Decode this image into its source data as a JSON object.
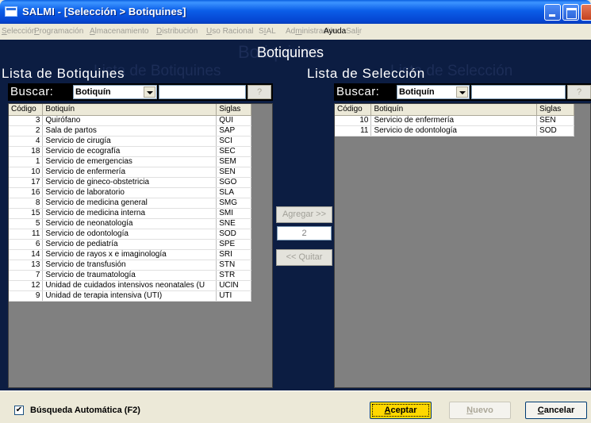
{
  "window": {
    "title": "SALMI - [Selección > Botiquines]"
  },
  "menu": [
    {
      "pre": "",
      "key": "S",
      "rest": "elección",
      "enabled": false
    },
    {
      "pre": "",
      "key": "P",
      "rest": "rogramación",
      "enabled": false
    },
    {
      "pre": "",
      "key": "A",
      "rest": "lmacenamiento",
      "enabled": false
    },
    {
      "pre": "",
      "key": "D",
      "rest": "istribución",
      "enabled": false
    },
    {
      "pre": "",
      "key": "U",
      "rest": "so Racional",
      "enabled": false
    },
    {
      "pre": "S",
      "key": "I",
      "rest": "AL",
      "enabled": false
    },
    {
      "pre": "Ad",
      "key": "m",
      "rest": "inistración",
      "enabled": false
    },
    {
      "pre": "",
      "key": "",
      "rest": "Ayuda",
      "enabled": true
    },
    {
      "pre": "Sal",
      "key": "i",
      "rest": "r",
      "enabled": false
    }
  ],
  "page": {
    "title": "Botiquines"
  },
  "left": {
    "title": "Lista de Botiquines",
    "search_label": "Buscar:",
    "search_field": "Botiquín",
    "search_value": "",
    "help_label": "?",
    "columns": [
      "Código",
      "Botiquín",
      "Siglas"
    ],
    "rows": [
      [
        "3",
        "Quirófano",
        "QUI"
      ],
      [
        "2",
        "Sala de partos",
        "SAP"
      ],
      [
        "4",
        "Servicio de cirugía",
        "SCI"
      ],
      [
        "18",
        "Servicio de ecografía",
        "SEC"
      ],
      [
        "1",
        "Servicio de emergencias",
        "SEM"
      ],
      [
        "10",
        "Servicio de enfermería",
        "SEN"
      ],
      [
        "17",
        "Servicio de gineco-obstetricia",
        "SGO"
      ],
      [
        "16",
        "Servicio de laboratorio",
        "SLA"
      ],
      [
        "8",
        "Servicio de medicina general",
        "SMG"
      ],
      [
        "15",
        "Servicio de medicina interna",
        "SMI"
      ],
      [
        "5",
        "Servicio de neonatología",
        "SNE"
      ],
      [
        "11",
        "Servicio de odontología",
        "SOD"
      ],
      [
        "6",
        "Servicio de pediatría",
        "SPE"
      ],
      [
        "14",
        "Servicio de rayos x e imaginología",
        "SRI"
      ],
      [
        "13",
        "Servicio de transfusión",
        "STN"
      ],
      [
        "7",
        "Servicio de traumatología",
        "STR"
      ],
      [
        "12",
        "Unidad de cuidados intensivos neonatales (U",
        "UCIN"
      ],
      [
        "9",
        "Unidad de terapia intensiva (UTI)",
        "UTI"
      ]
    ]
  },
  "middle": {
    "add_label": "Agregar >>",
    "count": "2",
    "remove_label": "<< Quitar"
  },
  "right": {
    "title": "Lista de Selección",
    "search_label": "Buscar:",
    "search_field": "Botiquín",
    "search_value": "",
    "help_label": "?",
    "columns": [
      "Código",
      "Botiquín",
      "Siglas"
    ],
    "rows": [
      [
        "10",
        "Servicio de enfermería",
        "SEN"
      ],
      [
        "11",
        "Servicio de odontología",
        "SOD"
      ]
    ]
  },
  "bottom": {
    "auto_search_label": "Búsqueda Automática (F2)",
    "auto_search_checked": true,
    "accept": {
      "key": "A",
      "rest": "ceptar"
    },
    "new": {
      "key": "N",
      "rest": "uevo"
    },
    "cancel": {
      "key": "C",
      "rest": "ancelar"
    }
  }
}
